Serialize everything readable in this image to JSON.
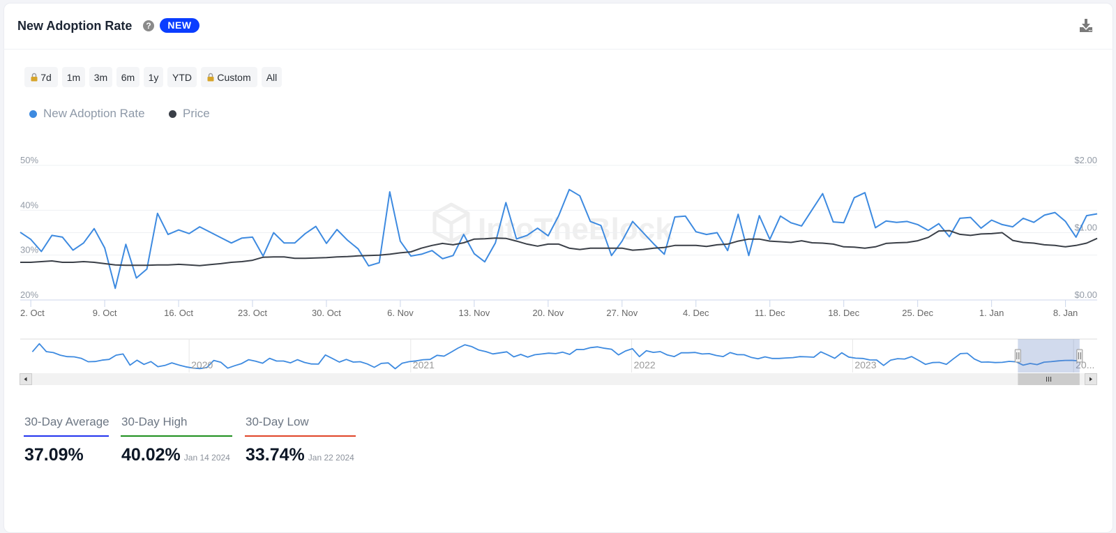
{
  "header": {
    "title": "New Adoption Rate",
    "help_icon": "?",
    "badge": "NEW"
  },
  "range_selector": {
    "buttons": [
      {
        "label": "7d",
        "locked": true
      },
      {
        "label": "1m",
        "locked": false
      },
      {
        "label": "3m",
        "locked": false
      },
      {
        "label": "6m",
        "locked": false
      },
      {
        "label": "1y",
        "locked": false
      },
      {
        "label": "YTD",
        "locked": false
      },
      {
        "label": "Custom",
        "locked": true
      },
      {
        "label": "All",
        "locked": false
      }
    ]
  },
  "legend": [
    {
      "label": "New Adoption Rate",
      "color": "#3d8ae0"
    },
    {
      "label": "Price",
      "color": "#3a3f47"
    }
  ],
  "watermark": {
    "text": "IntoTheBlock"
  },
  "chart_data": {
    "type": "line",
    "title": "New Adoption Rate",
    "xlabel": "",
    "ylabel": "",
    "legend_position": "top-left",
    "grid": true,
    "x_start": "2023-10-01",
    "x_end": "2024-01-11",
    "x_interval": "1 day",
    "x_ticks": [
      {
        "date": "2023-10-02",
        "label": "2. Oct"
      },
      {
        "date": "2023-10-09",
        "label": "9. Oct"
      },
      {
        "date": "2023-10-16",
        "label": "16. Oct"
      },
      {
        "date": "2023-10-23",
        "label": "23. Oct"
      },
      {
        "date": "2023-10-30",
        "label": "30. Oct"
      },
      {
        "date": "2023-11-06",
        "label": "6. Nov"
      },
      {
        "date": "2023-11-13",
        "label": "13. Nov"
      },
      {
        "date": "2023-11-20",
        "label": "20. Nov"
      },
      {
        "date": "2023-11-27",
        "label": "27. Nov"
      },
      {
        "date": "2023-12-04",
        "label": "4. Dec"
      },
      {
        "date": "2023-12-11",
        "label": "11. Dec"
      },
      {
        "date": "2023-12-18",
        "label": "18. Dec"
      },
      {
        "date": "2023-12-25",
        "label": "25. Dec"
      },
      {
        "date": "2024-01-01",
        "label": "1. Jan"
      },
      {
        "date": "2024-01-08",
        "label": "8. Jan"
      }
    ],
    "y_left": {
      "min": 20,
      "max": 50,
      "ticks": [
        {
          "value": 20,
          "label": "20%"
        },
        {
          "value": 30,
          "label": "30%"
        },
        {
          "value": 40,
          "label": "40%"
        },
        {
          "value": 50,
          "label": "50%"
        }
      ]
    },
    "y_right": {
      "min": 0,
      "max": 2,
      "ticks": [
        {
          "value": 0,
          "label": "$0.00"
        },
        {
          "value": 1,
          "label": "$1.00"
        },
        {
          "value": 2,
          "label": "$2.00"
        }
      ]
    },
    "series": [
      {
        "name": "New Adoption Rate",
        "axis": "left",
        "unit": "%",
        "color": "#3d8ae0",
        "values": [
          35.1,
          33.5,
          30.8,
          34.4,
          34.0,
          31.1,
          32.7,
          35.9,
          31.6,
          22.6,
          32.4,
          24.9,
          26.9,
          39.3,
          34.6,
          35.6,
          34.8,
          36.3,
          35.1,
          33.9,
          32.7,
          33.8,
          34.0,
          29.8,
          35.0,
          32.7,
          32.7,
          34.8,
          36.4,
          32.6,
          35.7,
          33.3,
          31.4,
          27.6,
          28.3,
          44.1,
          33.1,
          29.8,
          30.2,
          31.0,
          29.2,
          29.9,
          34.6,
          30.3,
          28.5,
          32.7,
          41.7,
          33.6,
          34.4,
          36.0,
          34.3,
          38.8,
          44.6,
          43.2,
          37.5,
          36.6,
          29.9,
          33.1,
          37.5,
          35.0,
          32.5,
          30.2,
          38.5,
          38.7,
          35.2,
          34.6,
          35.0,
          31.0,
          39.1,
          29.9,
          38.8,
          33.5,
          38.7,
          37.2,
          36.5,
          40.1,
          43.7,
          37.4,
          37.2,
          42.8,
          43.9,
          36.1,
          37.6,
          37.3,
          37.5,
          36.8,
          35.5,
          37.0,
          34.1,
          38.2,
          38.4,
          36.0,
          37.8,
          36.8,
          36.3,
          38.2,
          37.3,
          38.9,
          39.5,
          37.5,
          34.0,
          38.8,
          39.2
        ]
      },
      {
        "name": "Price",
        "axis": "right",
        "unit": "USD",
        "color": "#3a3f47",
        "values": [
          0.56,
          0.56,
          0.57,
          0.58,
          0.56,
          0.56,
          0.57,
          0.56,
          0.54,
          0.52,
          0.515,
          0.515,
          0.515,
          0.52,
          0.52,
          0.53,
          0.52,
          0.51,
          0.525,
          0.54,
          0.56,
          0.57,
          0.59,
          0.635,
          0.64,
          0.64,
          0.62,
          0.62,
          0.625,
          0.63,
          0.64,
          0.645,
          0.655,
          0.66,
          0.665,
          0.68,
          0.7,
          0.715,
          0.77,
          0.81,
          0.84,
          0.82,
          0.85,
          0.905,
          0.91,
          0.92,
          0.915,
          0.875,
          0.83,
          0.8,
          0.83,
          0.83,
          0.77,
          0.75,
          0.77,
          0.77,
          0.77,
          0.77,
          0.74,
          0.75,
          0.77,
          0.78,
          0.81,
          0.81,
          0.81,
          0.795,
          0.82,
          0.83,
          0.875,
          0.905,
          0.905,
          0.875,
          0.865,
          0.855,
          0.88,
          0.85,
          0.845,
          0.83,
          0.79,
          0.785,
          0.77,
          0.79,
          0.84,
          0.85,
          0.855,
          0.88,
          0.93,
          1.025,
          1.03,
          0.975,
          0.96,
          0.98,
          0.985,
          1.0,
          0.885,
          0.855,
          0.845,
          0.82,
          0.81,
          0.79,
          0.81,
          0.845,
          0.915
        ]
      }
    ]
  },
  "navigator": {
    "axis_start": "2019-03-28",
    "axis_end": "2024-02-09",
    "series_start": "2019-04-17",
    "series_end": "2024-01-10",
    "y_min": 20,
    "y_max": 70,
    "selection": {
      "from": "2023-10-01",
      "to": "2024-01-11"
    },
    "years": [
      {
        "date": "2020-01-01",
        "label": "2020"
      },
      {
        "date": "2021-01-01",
        "label": "2021"
      },
      {
        "date": "2022-01-01",
        "label": "2022"
      },
      {
        "date": "2023-01-01",
        "label": "2023"
      },
      {
        "date": "2024-01-01",
        "label": "20..."
      }
    ],
    "values": [
      50.9,
      63.0,
      51.3,
      49.8,
      45.9,
      43.7,
      43.4,
      41.3,
      36.1,
      36.5,
      38.5,
      39.6,
      45.9,
      47.7,
      31.0,
      38.4,
      32.2,
      36.4,
      28.7,
      30.6,
      34.5,
      31.3,
      28.5,
      26.8,
      25.9,
      27.4,
      38.1,
      35.4,
      26.6,
      30.2,
      33.4,
      39.2,
      37.0,
      34.0,
      41.3,
      37.2,
      37.2,
      34.5,
      39.2,
      35.1,
      32.8,
      32.6,
      46.3,
      41.0,
      35.6,
      39.6,
      35.6,
      36.1,
      32.8,
      27.8,
      33.6,
      34.4,
      25.7,
      34.0,
      36.2,
      37.4,
      39.2,
      39.6,
      45.7,
      44.5,
      50.3,
      56.5,
      61.5,
      58.6,
      53.5,
      51.2,
      47.8,
      49.4,
      50.9,
      43.4,
      47.1,
      43.0,
      46.6,
      47.7,
      49.0,
      48.2,
      50.4,
      47.1,
      54.5,
      54.4,
      57.2,
      58.3,
      56.2,
      54.8,
      46.4,
      52.2,
      55.6,
      43.8,
      52.6,
      50.1,
      51.3,
      46.2,
      43.9,
      49.5,
      49.5,
      50.0,
      47.7,
      48.2,
      45.5,
      43.9,
      49.8,
      46.8,
      46.6,
      42.7,
      40.5,
      43.4,
      41.0,
      41.0,
      41.8,
      42.3,
      43.7,
      43.4,
      42.9,
      50.9,
      46.3,
      41.3,
      49.5,
      43.1,
      41.5,
      41.0,
      38.9,
      38.8,
      30.6,
      38.5,
      40.7,
      40.2,
      43.9,
      38.2,
      32.2,
      34.9,
      35.2,
      32.3,
      40.5,
      48.2,
      48.7,
      40.2,
      35.5,
      35.7,
      34.9,
      35.2,
      36.7,
      36.0,
      31.0,
      33.5,
      31.9,
      35.5,
      36.2,
      37.4,
      38.1,
      38.2,
      37.3
    ]
  },
  "stats": [
    {
      "label": "30-Day Average",
      "value": "37.09%",
      "date": "",
      "color": "#2233ee"
    },
    {
      "label": "30-Day High",
      "value": "40.02%",
      "date": "Jan 14 2024",
      "color": "#1d8f1d"
    },
    {
      "label": "30-Day Low",
      "value": "33.74%",
      "date": "Jan 22 2024",
      "color": "#e04428"
    }
  ]
}
